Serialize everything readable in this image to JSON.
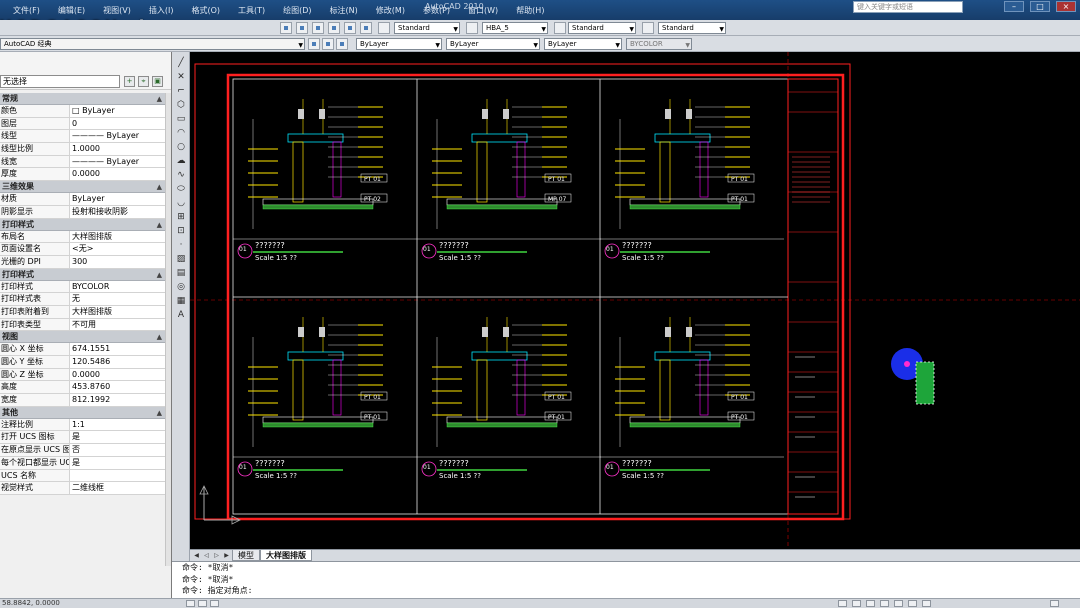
{
  "menubar": {
    "items": [
      "文件(F)",
      "编辑(E)",
      "视图(V)",
      "插入(I)",
      "格式(O)",
      "工具(T)",
      "绘图(D)",
      "标注(N)",
      "修改(M)",
      "参数(P)",
      "窗口(W)",
      "帮助(H)"
    ],
    "title": "AutoCAD 2010",
    "help_search_placeholder": "键入关键字或短语",
    "watermark": [
      "Y",
      "C",
      "D",
      "S",
      "A",
      "2",
      "3",
      "Y",
      "c",
      "d",
      "s",
      "a"
    ]
  },
  "toolbar": {
    "workspace": "AutoCAD 经典",
    "text_style": "Standard",
    "dim_style": "HBA_5",
    "table_style": "Standard",
    "multileader_style": "Standard",
    "layer": "ByLayer",
    "linetype": "ByLayer",
    "lineweight": "ByLayer",
    "plotstyle": "BYCOLOR"
  },
  "palette": {
    "selection": "无选择",
    "sections": [
      {
        "title": "常规",
        "rows": [
          {
            "k": "颜色",
            "v": "□ ByLayer"
          },
          {
            "k": "图层",
            "v": "0"
          },
          {
            "k": "线型",
            "v": "———— ByLayer"
          },
          {
            "k": "线型比例",
            "v": "1.0000"
          },
          {
            "k": "线宽",
            "v": "———— ByLayer"
          },
          {
            "k": "厚度",
            "v": "0.0000"
          }
        ]
      },
      {
        "title": "三维效果",
        "rows": [
          {
            "k": "材质",
            "v": "ByLayer"
          },
          {
            "k": "阴影显示",
            "v": "投射和接收阴影"
          }
        ]
      },
      {
        "title": "打印样式",
        "rows": [
          {
            "k": "布局名",
            "v": "大样图排版"
          },
          {
            "k": "页面设置名",
            "v": "<无>"
          },
          {
            "k": "光栅的 DPI",
            "v": "300"
          }
        ]
      },
      {
        "title": "打印样式",
        "rows": [
          {
            "k": "打印样式",
            "v": "BYCOLOR"
          },
          {
            "k": "打印样式表",
            "v": "无"
          },
          {
            "k": "打印表附着到",
            "v": "大样图排版"
          },
          {
            "k": "打印表类型",
            "v": "不可用"
          }
        ]
      },
      {
        "title": "视图",
        "rows": [
          {
            "k": "圆心 X 坐标",
            "v": "674.1551"
          },
          {
            "k": "圆心 Y 坐标",
            "v": "120.5486"
          },
          {
            "k": "圆心 Z 坐标",
            "v": "0.0000"
          },
          {
            "k": "高度",
            "v": "453.8760"
          },
          {
            "k": "宽度",
            "v": "812.1992"
          }
        ]
      },
      {
        "title": "其他",
        "rows": [
          {
            "k": "注释比例",
            "v": "1:1"
          },
          {
            "k": "打开 UCS 图标",
            "v": "是"
          },
          {
            "k": "在原点显示 UCS 图标",
            "v": "否"
          },
          {
            "k": "每个视口都显示 UCS",
            "v": "是"
          },
          {
            "k": "UCS 名称",
            "v": ""
          },
          {
            "k": "视觉样式",
            "v": "二维线框"
          }
        ]
      }
    ]
  },
  "drawing": {
    "panels": [
      {
        "id": "01",
        "title": "???????",
        "scale": "Scale 1:5   ??"
      },
      {
        "id": "01",
        "title": "???????",
        "scale": "Scale 1:5   ??"
      },
      {
        "id": "01",
        "title": "???????",
        "scale": "Scale 1:5   ??"
      },
      {
        "id": "01",
        "title": "???????",
        "scale": "Scale 1:5   ??"
      },
      {
        "id": "01",
        "title": "???????",
        "scale": "Scale 1:5   ??"
      },
      {
        "id": "01",
        "title": "???????",
        "scale": "Scale 1:5   ??"
      }
    ],
    "tags": [
      "PT 01",
      "PT 02",
      "PT 01",
      "MP 07",
      "PT 01",
      "PT 01",
      "PT 01",
      "PT 01",
      "PT 01",
      "PT 01",
      "PT 01"
    ]
  },
  "tabs": {
    "model": "模型",
    "layout": "大样图排版"
  },
  "command": {
    "lines": [
      "命令: *取消*",
      "命令: *取消*",
      "命令: 指定对角点:"
    ]
  },
  "status": {
    "coords": "58.8842, 0.0000"
  }
}
